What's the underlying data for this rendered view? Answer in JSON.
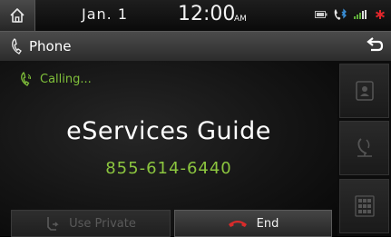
{
  "status_bar": {
    "date": "Jan.  1",
    "time": "12:00",
    "ampm": "AM",
    "icons": [
      "battery-icon",
      "bluetooth-phone-icon",
      "signal-icon",
      "mute-icon"
    ],
    "accent_red": "#e0262b"
  },
  "title_bar": {
    "title": "Phone"
  },
  "call": {
    "status": "Calling...",
    "contact_name": "eServices Guide",
    "contact_number": "855-614-6440",
    "status_color": "#7fbf3a"
  },
  "buttons": {
    "use_private": "Use Private",
    "end": "End"
  },
  "side_buttons": [
    "contacts-icon",
    "mic-mute-icon",
    "keypad-icon"
  ]
}
